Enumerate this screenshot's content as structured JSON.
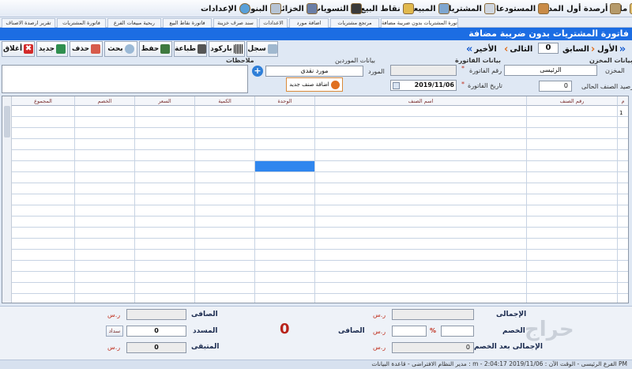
{
  "menu": [
    {
      "label": "ملف",
      "icon": "file-icon",
      "color": "#e0c070"
    },
    {
      "label": "أرصدة أول المده",
      "icon": "balances-icon",
      "color": "#b59a6a"
    },
    {
      "label": "المستودعات",
      "icon": "warehouse-icon",
      "color": "#c98b47"
    },
    {
      "label": "المشتريات",
      "icon": "cart-icon",
      "color": "#cfd6df"
    },
    {
      "label": "المبيعات",
      "icon": "sales-icon",
      "color": "#7ea6cf"
    },
    {
      "label": "نقاط البيع",
      "icon": "pos-icon",
      "color": "#e1b94e"
    },
    {
      "label": "التسويات",
      "icon": "settlement-icon",
      "color": "#3a3a3a"
    },
    {
      "label": "الخزائن",
      "icon": "safe-icon",
      "color": "#6a7ea6"
    },
    {
      "label": "البنوك",
      "icon": "bank-icon",
      "color": "#b7c4d4"
    },
    {
      "label": "الإعدادات",
      "icon": "settings-icon",
      "color": "#59a0d9"
    }
  ],
  "tabs": [
    "فاتورة المشتريات بدون ضريبة مضافة",
    "مرتجع مشتريات",
    "اضافة مورد",
    "الاعدادات",
    "سند صرف خزينة",
    "فاتورة نقاط البيع",
    "ربحية مبيعات الفرع",
    "فاتورة المشتريات",
    "تقرير ارصدة الاصناف"
  ],
  "title": "فاتورة المشتريات بدون ضريبة مضافة",
  "toolbar": {
    "close": "أغلاق",
    "new": "جديد",
    "delete": "حذف",
    "search": "بحث",
    "save": "حفظ",
    "print": "طباعة",
    "barcode": "باركود",
    "log": "سجل"
  },
  "nav": {
    "first": "الأول",
    "prev": "السابق",
    "record": "0",
    "next": "التالى",
    "last": "الأخير"
  },
  "warehouse": {
    "section": "بيانات المخزن",
    "store_label": "المخزن",
    "store_value": "الرئيسى",
    "balance_label": "رصيد الصنف الحالى",
    "balance_value": "0"
  },
  "invoice": {
    "section": "بيانات الفاتورة",
    "number_label": "رقم الفاتورة",
    "date_label": "تاريخ الفاتورة",
    "date_value": "2019/11/06",
    "required_mark": "*"
  },
  "supplier": {
    "section": "بيانات الموردين",
    "label": "المورد",
    "value": "مورد نقدى",
    "add_item": "اضافة صنف جديد"
  },
  "notes_label": "ملاحظات",
  "grid": {
    "columns": [
      "م",
      "رقم الصنف",
      "اسم الصنف",
      "الوحدة",
      "الكمية",
      "السعر",
      "الخصم",
      "المجموع"
    ],
    "first_row": "1"
  },
  "totals": {
    "total_label": "الإجمالى",
    "discount_label": "الخصم",
    "after_discount_label": "الإجمالى بعد الخصم",
    "net_label": "الصافى",
    "net_value": "0",
    "percent": "%",
    "currency": "ر.س",
    "paid_label": "المسدد",
    "paid_value": "0",
    "pay_button": "سداد",
    "remaining_label": "المتبقى",
    "remaining_value": "0",
    "big_total": "0",
    "after_discount_value": "0",
    "safe_value": ""
  },
  "status": "مدير النظام الافتراضى - قاعدة البيانات : m - الفرع الرئيسى - الوقت الآن : 2019/11/06 2:04:17 PM",
  "watermark": "حراج"
}
